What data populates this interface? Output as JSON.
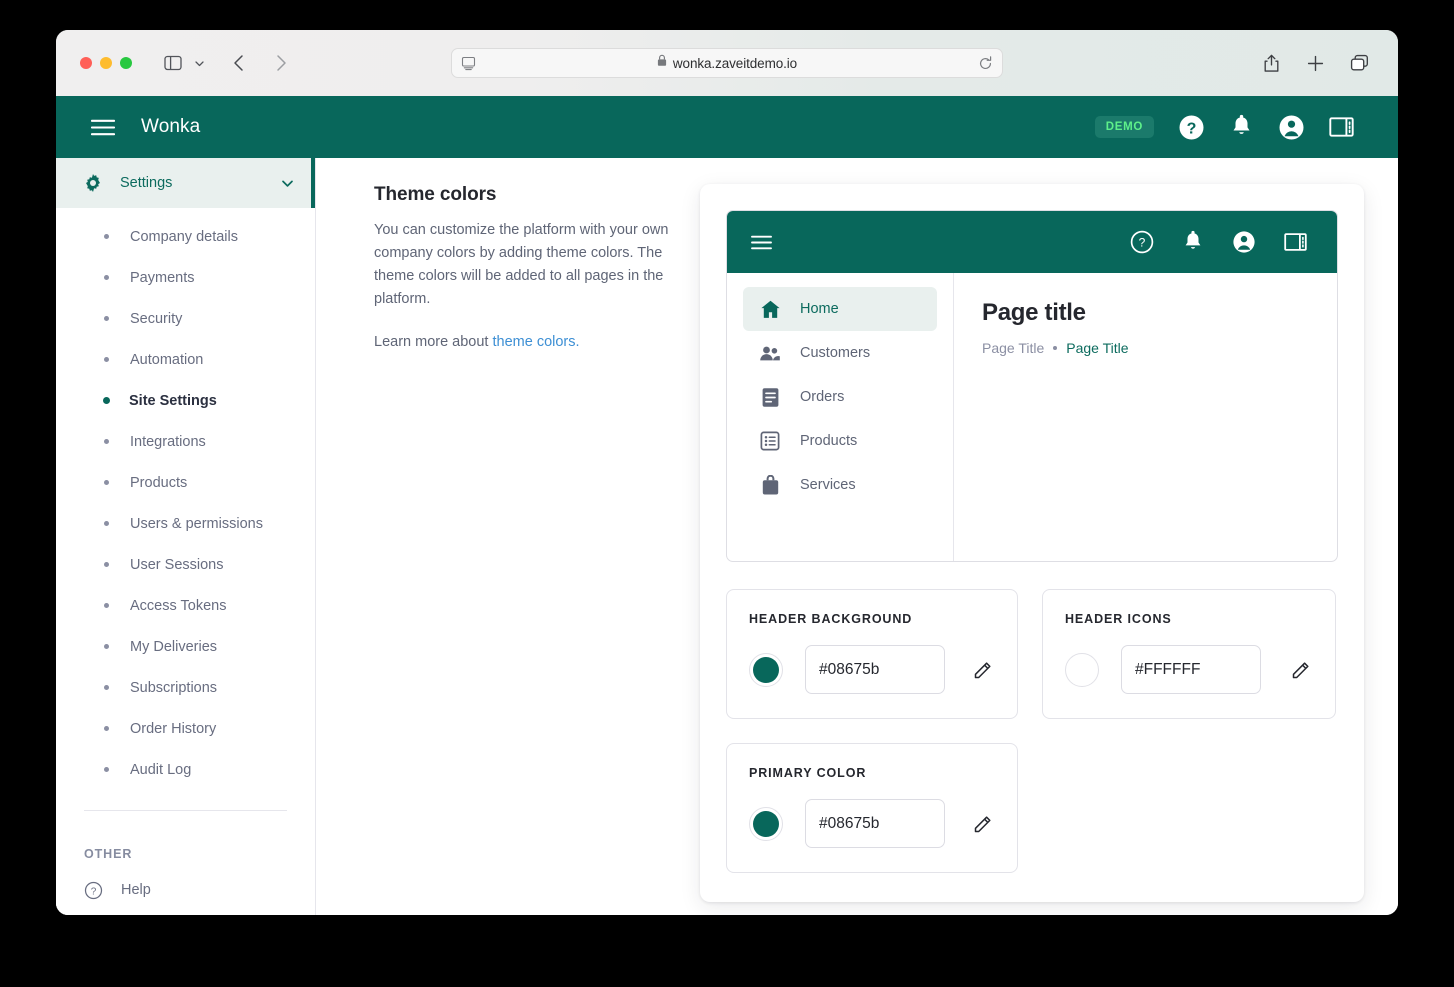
{
  "browser": {
    "url": "wonka.zaveitdemo.io",
    "lock_icon": "lock-icon",
    "sidebar_toggle_icon": "sidebar-toggle-icon",
    "tab_overview_chevron_icon": "chevron-down-icon",
    "back_icon": "back-arrow-icon",
    "forward_icon": "forward-arrow-icon",
    "reader_icon": "reader-view-icon",
    "reload_icon": "reload-icon",
    "share_icon": "share-icon",
    "new_tab_icon": "plus-icon",
    "tabs_icon": "tabs-overview-icon"
  },
  "app_header": {
    "menu_icon": "hamburger-menu-icon",
    "brand": "Wonka",
    "demo_badge": "DEMO",
    "help_icon": "help-circle-icon",
    "notifications_icon": "bell-icon",
    "account_icon": "account-circle-icon",
    "panel_icon": "side-panel-icon"
  },
  "sidebar": {
    "group": {
      "label": "Settings",
      "gear_icon": "gear-icon",
      "chevron_icon": "chevron-down-icon"
    },
    "items": [
      {
        "label": "Company details",
        "active": false
      },
      {
        "label": "Payments",
        "active": false
      },
      {
        "label": "Security",
        "active": false
      },
      {
        "label": "Automation",
        "active": false
      },
      {
        "label": "Site Settings",
        "active": true
      },
      {
        "label": "Integrations",
        "active": false
      },
      {
        "label": "Products",
        "active": false
      },
      {
        "label": "Users & permissions",
        "active": false
      },
      {
        "label": "User Sessions",
        "active": false
      },
      {
        "label": "Access Tokens",
        "active": false
      },
      {
        "label": "My Deliveries",
        "active": false
      },
      {
        "label": "Subscriptions",
        "active": false
      },
      {
        "label": "Order History",
        "active": false
      },
      {
        "label": "Audit Log",
        "active": false
      }
    ],
    "other_section_title": "OTHER",
    "help_item": {
      "label": "Help",
      "icon": "help-circle-outline-icon"
    }
  },
  "description": {
    "title": "Theme colors",
    "body": "You can customize the platform with your own company colors by adding theme colors. The theme colors will be added to all pages in the platform.",
    "learn_prefix": "Learn more about",
    "learn_link": "theme colors."
  },
  "preview": {
    "header": {
      "menu_icon": "hamburger-menu-icon",
      "help_icon": "help-circle-outline-icon",
      "notifications_icon": "bell-icon",
      "account_icon": "account-circle-icon",
      "panel_icon": "side-panel-icon"
    },
    "nav_items": [
      {
        "label": "Home",
        "icon": "home-icon",
        "active": true
      },
      {
        "label": "Customers",
        "icon": "people-icon",
        "active": false
      },
      {
        "label": "Orders",
        "icon": "document-icon",
        "active": false
      },
      {
        "label": "Products",
        "icon": "list-box-icon",
        "active": false
      },
      {
        "label": "Services",
        "icon": "briefcase-icon",
        "active": false
      }
    ],
    "page_title": "Page title",
    "breadcrumb_parent": "Page Title",
    "breadcrumb_current": "Page Title"
  },
  "color_cards": [
    {
      "title": "HEADER BACKGROUND",
      "value": "#08675b",
      "swatch": "#08675b",
      "edit_icon": "pencil-icon"
    },
    {
      "title": "HEADER ICONS",
      "value": "#FFFFFF",
      "swatch": "#ffffff",
      "edit_icon": "pencil-icon"
    },
    {
      "title": "PRIMARY COLOR",
      "value": "#08675b",
      "swatch": "#08675b",
      "edit_icon": "pencil-icon"
    }
  ],
  "theme": {
    "brand_teal": "#08675b",
    "mint": "#e9f0ee",
    "link_blue": "#3d8fd4",
    "demo_green": "#5ef08a"
  }
}
